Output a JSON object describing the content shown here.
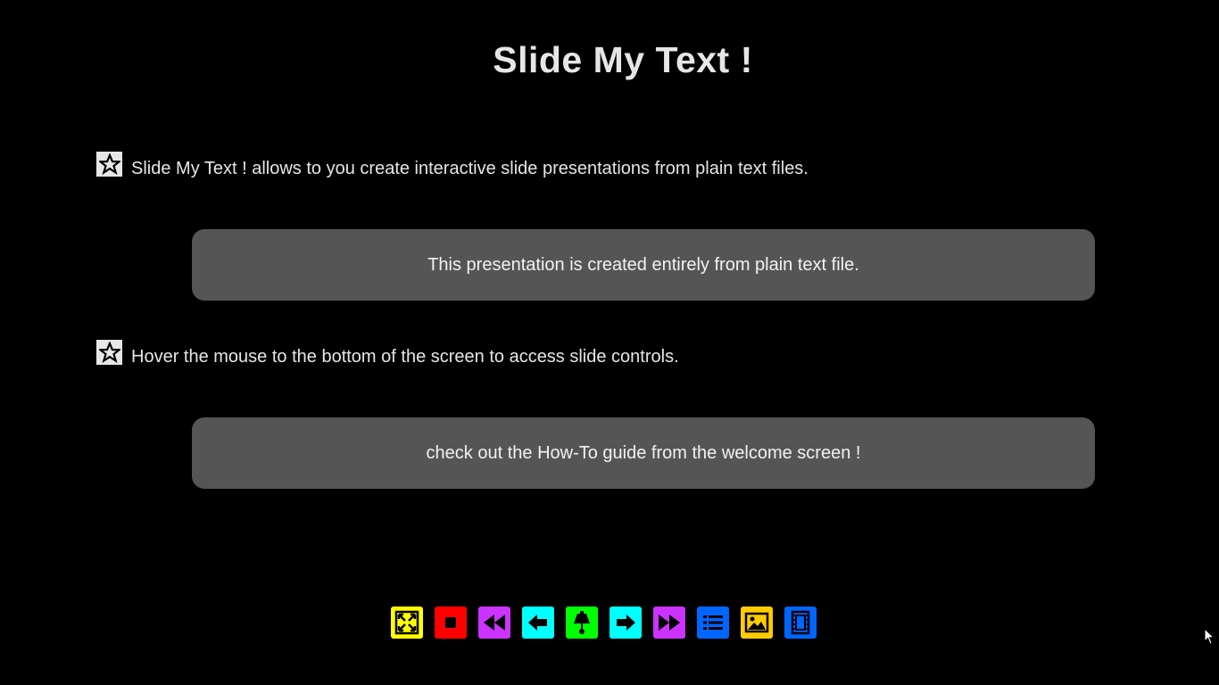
{
  "slide": {
    "title": "Slide My Text !",
    "bullets": [
      {
        "icon": "star-icon",
        "text": "Slide My Text ! allows to you create interactive slide presentations from plain text files.",
        "note": "This presentation is created entirely from plain text file."
      },
      {
        "icon": "star-icon",
        "text": "Hover the mouse to the bottom of the screen to access slide controls.",
        "note": "check out the How-To guide from the welcome screen !"
      }
    ]
  },
  "controls": [
    {
      "name": "fullscreen-button",
      "icon": "fullscreen-icon",
      "color": "#ffff00"
    },
    {
      "name": "stop-button",
      "icon": "stop-icon",
      "color": "#ff0000"
    },
    {
      "name": "first-slide-button",
      "icon": "rewind-icon",
      "color": "#cc33ff"
    },
    {
      "name": "previous-slide-button",
      "icon": "arrow-left-icon",
      "color": "#00ffff"
    },
    {
      "name": "presenter-button",
      "icon": "lamp-icon",
      "color": "#00ff00"
    },
    {
      "name": "next-slide-button",
      "icon": "arrow-right-icon",
      "color": "#00ffff"
    },
    {
      "name": "last-slide-button",
      "icon": "fast-forward-icon",
      "color": "#cc33ff"
    },
    {
      "name": "slide-list-button",
      "icon": "list-icon",
      "color": "#0066ff"
    },
    {
      "name": "image-button",
      "icon": "image-icon",
      "color": "#ffcc00"
    },
    {
      "name": "film-button",
      "icon": "film-icon",
      "color": "#0066ff"
    }
  ],
  "colors": {
    "background": "#000000",
    "text": "#e6e6e6",
    "note_background": "#555555"
  }
}
